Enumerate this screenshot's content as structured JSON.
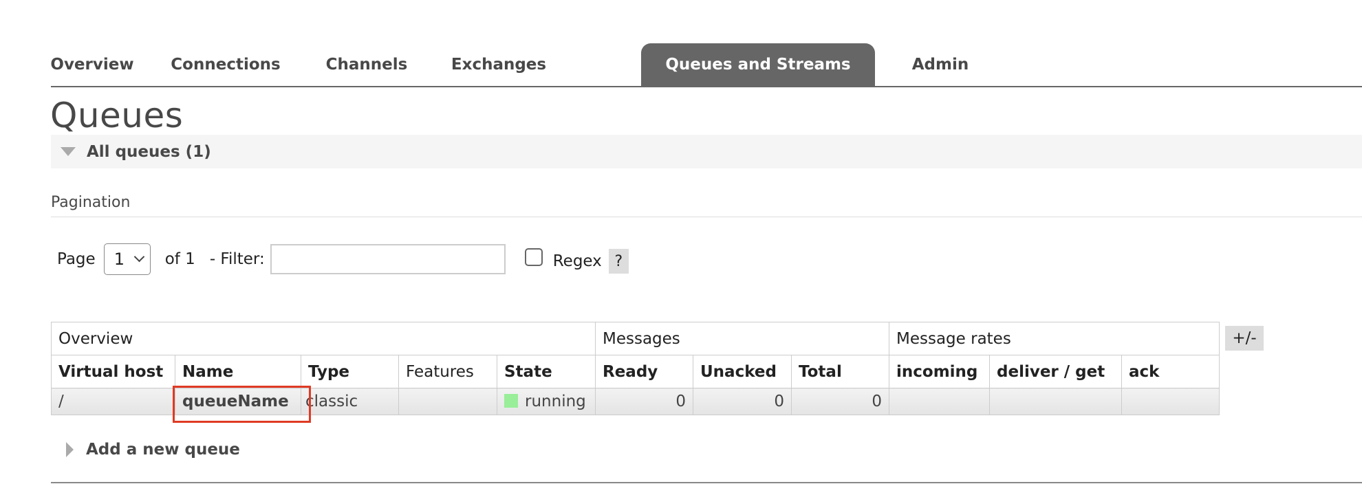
{
  "nav": {
    "tabs": [
      {
        "label": "Overview",
        "active": false
      },
      {
        "label": "Connections",
        "active": false
      },
      {
        "label": "Channels",
        "active": false
      },
      {
        "label": "Exchanges",
        "active": false
      },
      {
        "label": "Queues and Streams",
        "active": true
      },
      {
        "label": "Admin",
        "active": false
      }
    ]
  },
  "page": {
    "title": "Queues",
    "section_title": "All queues (1)"
  },
  "pagination": {
    "heading": "Pagination",
    "page_label": "Page",
    "page_value": "1",
    "of_text": "of 1",
    "filter_label": "- Filter:",
    "filter_value": "",
    "regex_label": "Regex",
    "regex_checked": false,
    "help_label": "?"
  },
  "table": {
    "groups": {
      "overview": "Overview",
      "messages": "Messages",
      "message_rates": "Message rates"
    },
    "columns": {
      "vhost": "Virtual host",
      "name": "Name",
      "type": "Type",
      "features": "Features",
      "state": "State",
      "ready": "Ready",
      "unacked": "Unacked",
      "total": "Total",
      "incoming": "incoming",
      "deliver_get": "deliver / get",
      "ack": "ack"
    },
    "rows": [
      {
        "vhost": "/",
        "name": "queueName",
        "type": "classic",
        "features": "",
        "state": "running",
        "ready": "0",
        "unacked": "0",
        "total": "0",
        "incoming": "",
        "deliver_get": "",
        "ack": ""
      }
    ],
    "plus_minus_label": "+/-"
  },
  "add_queue": {
    "label": "Add a new queue"
  },
  "colors": {
    "active_tab_bg": "#666666",
    "running_indicator": "#99ee99",
    "highlight_box": "#e03a24"
  }
}
